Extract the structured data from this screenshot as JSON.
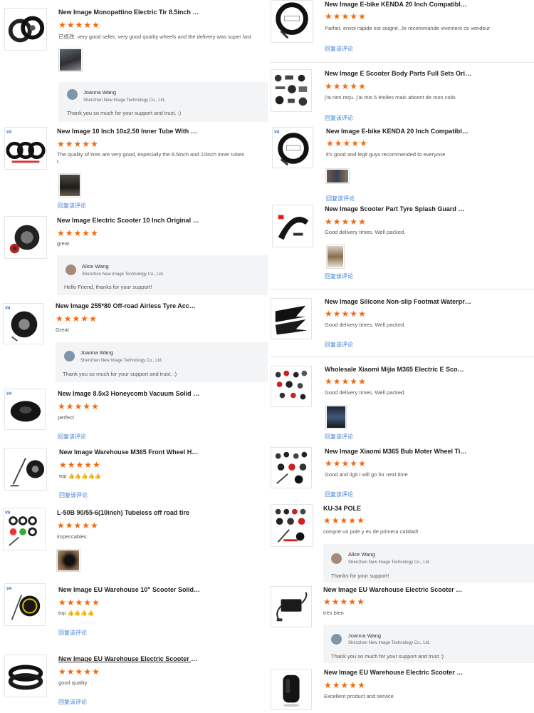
{
  "reply_link_label": "回复该评论",
  "star_color": "#f5690e",
  "reply_company": "Shenzhen New Image Technology Co., Ltd.",
  "left_reviews": [
    {
      "title": "New Image Monopattino Electric Tir 8.5inch So...",
      "rating": 5,
      "text": "已修改: very good seller, very good quality wheels and the delivery was super fast",
      "has_photo": true
    },
    {
      "title": "New Image 10 Inch 10x2.50 Inner Tube With B...",
      "rating": 5,
      "text": "The quality of tires are very good, especially the 8.5inch and 10inch inner tubes",
      "text2": "r.",
      "has_photo": true,
      "reply_link": true
    },
    {
      "title": "New Image Electric Scooter 10 Inch Original Va...",
      "rating": 5,
      "text": "great"
    },
    {
      "title": "New Image 255*80 Off-road Airless Tyre Acces...",
      "rating": 5,
      "text": "Great"
    },
    {
      "title": "New Image 8.5x3 Honeycomb Vacuum Solid Ti...",
      "rating": 5,
      "text": "perfect",
      "reply_link": true
    },
    {
      "title": "New Image Warehouse M365 Front Wheel Hub ...",
      "rating": 5,
      "text": "top 👍👍👍👍👍",
      "reply_link": true
    },
    {
      "title": "L-50B 90/55-6(10inch) Tubeless off road tire",
      "rating": 5,
      "text": "impeccables",
      "has_photo": true
    },
    {
      "title": "New Image EU Warehouse 10\" Scooter Solid Ti...",
      "rating": 5,
      "text": "top 👍👍👍👍",
      "reply_link": true
    },
    {
      "title": "New Image EU Warehouse Electric Scooter 10 I...",
      "rating": 5,
      "text": "good quality",
      "reply_link": true
    }
  ],
  "left_replies": [
    {
      "name": "Joanna Wang",
      "text": "Thank you so much for your support and trust. :)"
    },
    {
      "name": "Alice Wang",
      "text": "Hello Friend, thanks for your support!"
    },
    {
      "name": "Joanna Wang",
      "text": "Thank you so much for your support and trust. :)"
    }
  ],
  "right_reviews": [
    {
      "title": "New Image E-bike KENDA 20 Inch Compatible ...",
      "rating": 5,
      "text": "Parfait. envoi rapide est soigné. Je recommande vivement ce vendeur",
      "reply_link": true
    },
    {
      "title": "New Image E Scooter Body Parts Full Sets Orig...",
      "rating": 5,
      "text": "j'ai rien reçu. j'ai mis 5 étoiles mais absent de mon colis",
      "reply_link": true
    },
    {
      "title": "New Image E-bike KENDA 20 Inch Compatible ...",
      "rating": 5,
      "text": "it's good and legit guys recommended to everyone",
      "has_photo": true,
      "reply_link": true
    },
    {
      "title": "New Image Scooter Part Tyre Splash Guard Re...",
      "rating": 5,
      "text": "Good delivery times. Well packed.",
      "has_photo": true,
      "reply_link": true
    },
    {
      "title": "New Image Silicone Non-slip Footmat Waterproof Foo...",
      "rating": 5,
      "text": "Good delivery times. Well packed.",
      "reply_link": true
    },
    {
      "title": "Wholesale Xiaomi Mijia M365 Electric E Scoote...",
      "rating": 5,
      "text": "Good delivery times. Well packed.",
      "has_photo": true,
      "reply_link": true
    },
    {
      "title": "New Image Xiaomi M365 Bub Moter Wheel Tir...",
      "rating": 5,
      "text": "Good and ligit I will go for next time",
      "reply_link": true
    },
    {
      "title": "KU-34 POLE",
      "rating": 5,
      "text": "compre un pole y es de primera calidad!"
    },
    {
      "title": "New Image EU Warehouse Electric Scooter 42...",
      "rating": 5,
      "text": "très bien"
    },
    {
      "title": "New Image EU Warehouse Electric Scooter EV...",
      "rating": 5,
      "text": "Excellent product and service"
    }
  ],
  "right_replies": [
    {
      "name": "Alice Wang",
      "text": "Thanks for your support!"
    },
    {
      "name": "Joanna Wang",
      "text": "Thank you so much for your support and trust :)"
    }
  ]
}
